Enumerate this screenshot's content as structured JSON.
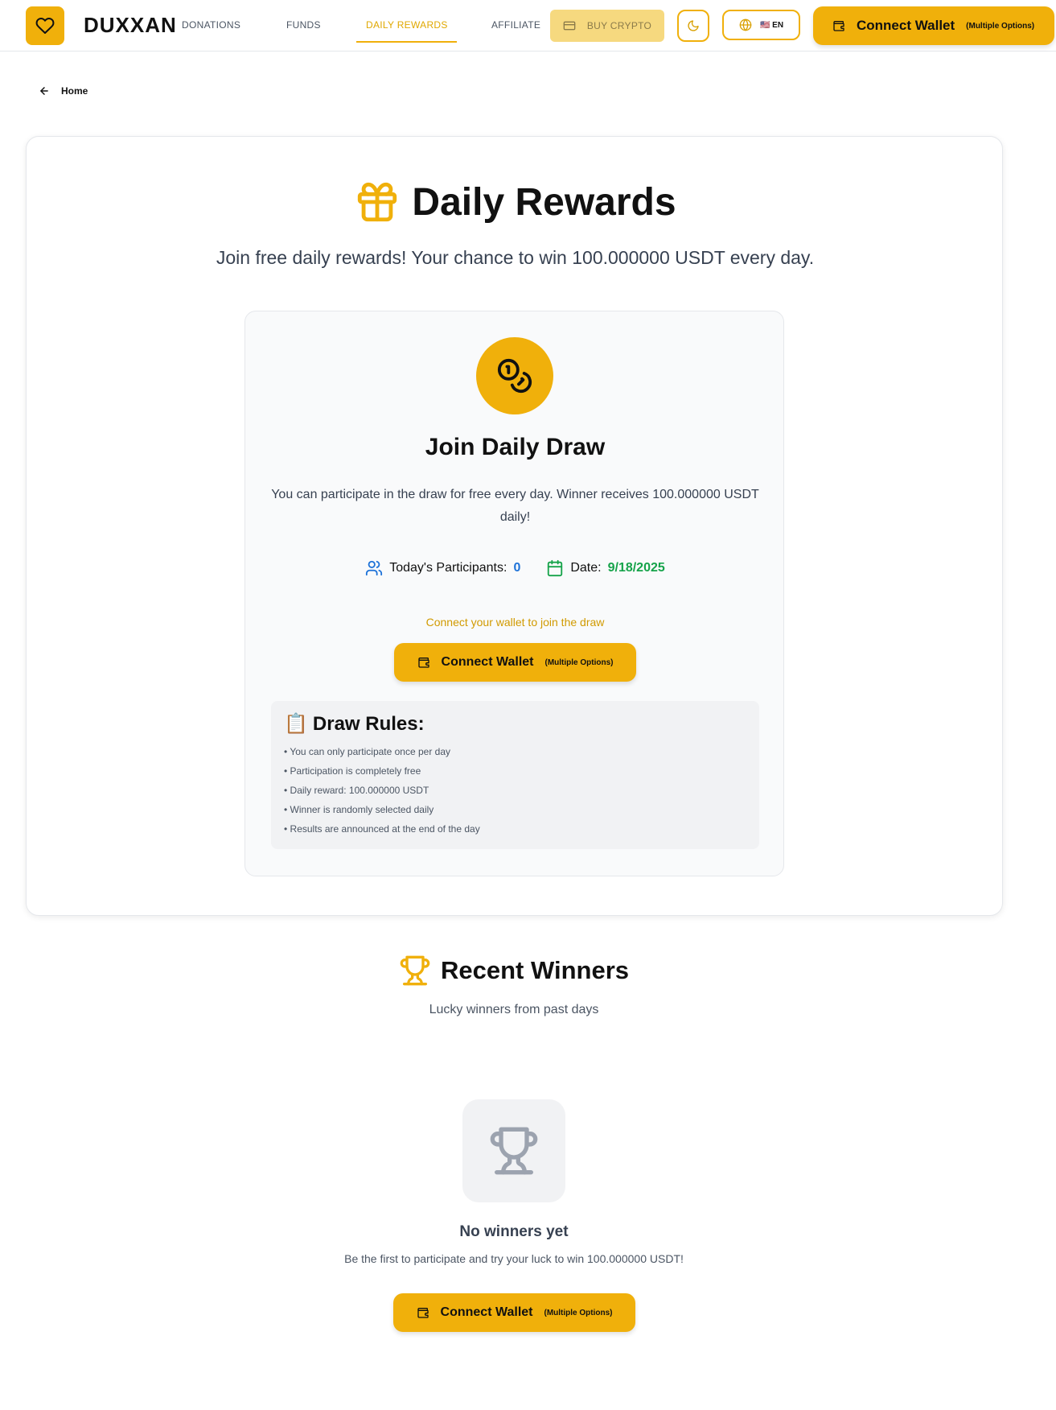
{
  "brand": "DUXXAN",
  "nav": {
    "donations": "DONATIONS",
    "funds": "FUNDS",
    "daily_rewards": "DAILY REWARDS",
    "affiliate": "AFFILIATE",
    "buy_crypto": "BUY CRYPTO",
    "language": "🇺🇸 EN",
    "connect_wallet": "Connect Wallet",
    "connect_wallet_sub": "(Multiple Options)"
  },
  "breadcrumb": {
    "home": "Home"
  },
  "hero": {
    "title": "Daily Rewards",
    "subtitle": "Join free daily rewards! Your chance to win 100.000000 USDT every day."
  },
  "draw": {
    "title": "Join Daily Draw",
    "description": "You can participate in the draw for free every day. Winner receives 100.000000 USDT daily!",
    "participants_label": "Today's Participants:",
    "participants_value": "0",
    "date_label": "Date:",
    "date_value": "9/18/2025",
    "connect_note": "Connect your wallet to join the draw",
    "connect_wallet": "Connect Wallet",
    "connect_wallet_sub": "(Multiple Options)"
  },
  "rules": {
    "emoji": "📋",
    "title": "Draw Rules:",
    "items": [
      "• You can only participate once per day",
      "• Participation is completely free",
      "• Daily reward: 100.000000 USDT",
      "• Winner is randomly selected daily",
      "• Results are announced at the end of the day"
    ]
  },
  "winners": {
    "title": "Recent Winners",
    "subtitle": "Lucky winners from past days",
    "empty_title": "No winners yet",
    "empty_desc": "Be the first to participate and try your luck to win 100.000000 USDT!",
    "connect_wallet": "Connect Wallet",
    "connect_wallet_sub": "(Multiple Options)"
  },
  "colors": {
    "accent": "#f0b00b",
    "accent_text": "#e0a800",
    "blue": "#1d72d8",
    "green": "#16a34a"
  },
  "icons": [
    "heart-icon",
    "credit-card-icon",
    "moon-icon",
    "globe-icon",
    "wallet-icon",
    "arrow-left-icon",
    "gift-icon",
    "coins-icon",
    "users-icon",
    "calendar-icon",
    "trophy-icon"
  ]
}
